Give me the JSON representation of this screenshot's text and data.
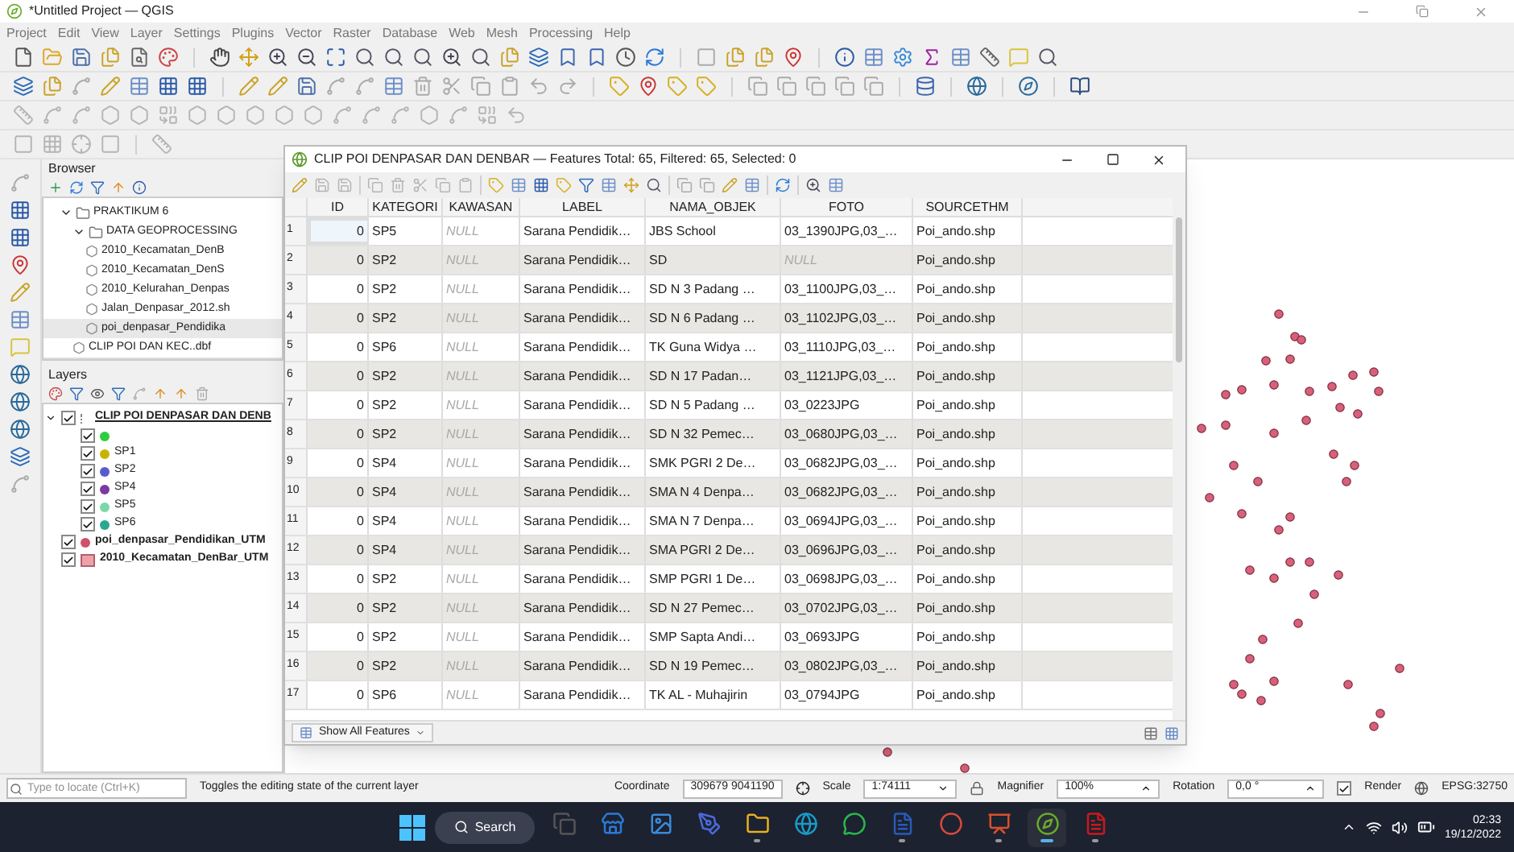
{
  "window": {
    "title": "*Untitled Project — QGIS"
  },
  "menu": [
    "Project",
    "Edit",
    "View",
    "Layer",
    "Settings",
    "Plugins",
    "Vector",
    "Raster",
    "Database",
    "Web",
    "Mesh",
    "Processing",
    "Help"
  ],
  "browser": {
    "title": "Browser",
    "items": [
      {
        "label": "PRAKTIKUM 6",
        "kind": "folder",
        "expanded": true,
        "selected": false,
        "children": [
          {
            "label": "DATA GEOPROCESSING",
            "kind": "folder",
            "expanded": true,
            "selected": false,
            "children": [
              {
                "label": "2010_Kecamatan_DenB",
                "kind": "file",
                "selected": false
              },
              {
                "label": "2010_Kecamatan_DenS",
                "kind": "file",
                "selected": false
              },
              {
                "label": "2010_Kelurahan_Denpas",
                "kind": "file",
                "selected": false
              },
              {
                "label": "Jalan_Denpasar_2012.sh",
                "kind": "file",
                "selected": false
              },
              {
                "label": "poi_denpasar_Pendidika",
                "kind": "file",
                "selected": true
              }
            ]
          },
          {
            "label": "CLIP POI DAN KEC..dbf",
            "kind": "file",
            "selected": false
          }
        ]
      }
    ]
  },
  "layers": {
    "title": "Layers",
    "items": [
      {
        "label": "CLIP POI DENPASAR DAN DENB",
        "checked": true,
        "expanded": true,
        "kind": "group",
        "children": [
          {
            "checked": true,
            "kind": "point",
            "color": "#2ecc40"
          },
          {
            "label": "SP1",
            "checked": true,
            "kind": "point",
            "color": "#c8b400"
          },
          {
            "label": "SP2",
            "checked": true,
            "kind": "point",
            "color": "#5a5ad0"
          },
          {
            "label": "SP4",
            "checked": true,
            "kind": "point",
            "color": "#7a3aa0"
          },
          {
            "label": "SP5",
            "checked": true,
            "kind": "point",
            "color": "#7ad8a8"
          },
          {
            "label": "SP6",
            "checked": true,
            "kind": "point",
            "color": "#2aa890"
          }
        ]
      },
      {
        "label": "poi_denpasar_Pendidikan_UTM",
        "checked": true,
        "kind": "point",
        "color": "#d0506a"
      },
      {
        "label": "2010_Kecamatan_DenBar_UTM",
        "checked": true,
        "kind": "polygon",
        "color": "#f0a0a8"
      }
    ]
  },
  "attribute_table": {
    "title": "CLIP POI DENPASAR DAN DENBAR — Features Total: 65, Filtered: 65, Selected: 0",
    "columns": [
      "ID",
      "KATEGORI",
      "KAWASAN",
      "LABEL",
      "NAMA_OBJEK",
      "FOTO",
      "SOURCETHM"
    ],
    "rows": [
      {
        "number": "1",
        "cells": [
          {
            "text": "0",
            "null": false,
            "focused": true
          },
          {
            "text": "SP5",
            "null": false,
            "focused": false
          },
          {
            "text": "NULL",
            "null": true,
            "focused": false
          },
          {
            "text": "Sarana Pendidik…",
            "null": false,
            "focused": false
          },
          {
            "text": "JBS School",
            "null": false,
            "focused": false
          },
          {
            "text": "03_1390JPG,03_…",
            "null": false,
            "focused": false
          },
          {
            "text": "Poi_ando.shp",
            "null": false,
            "focused": false
          }
        ]
      },
      {
        "number": "2",
        "cells": [
          {
            "text": "0",
            "null": false,
            "focused": false
          },
          {
            "text": "SP2",
            "null": false,
            "focused": false
          },
          {
            "text": "NULL",
            "null": true,
            "focused": false
          },
          {
            "text": "Sarana Pendidik…",
            "null": false,
            "focused": false
          },
          {
            "text": "SD",
            "null": false,
            "focused": false
          },
          {
            "text": "NULL",
            "null": true,
            "focused": false
          },
          {
            "text": "Poi_ando.shp",
            "null": false,
            "focused": false
          }
        ]
      },
      {
        "number": "3",
        "cells": [
          {
            "text": "0",
            "null": false,
            "focused": false
          },
          {
            "text": "SP2",
            "null": false,
            "focused": false
          },
          {
            "text": "NULL",
            "null": true,
            "focused": false
          },
          {
            "text": "Sarana Pendidik…",
            "null": false,
            "focused": false
          },
          {
            "text": "SD N 3 Padang …",
            "null": false,
            "focused": false
          },
          {
            "text": "03_1100JPG,03_…",
            "null": false,
            "focused": false
          },
          {
            "text": "Poi_ando.shp",
            "null": false,
            "focused": false
          }
        ]
      },
      {
        "number": "4",
        "cells": [
          {
            "text": "0",
            "null": false,
            "focused": false
          },
          {
            "text": "SP2",
            "null": false,
            "focused": false
          },
          {
            "text": "NULL",
            "null": true,
            "focused": false
          },
          {
            "text": "Sarana Pendidik…",
            "null": false,
            "focused": false
          },
          {
            "text": "SD N 6 Padang …",
            "null": false,
            "focused": false
          },
          {
            "text": "03_1102JPG,03_…",
            "null": false,
            "focused": false
          },
          {
            "text": "Poi_ando.shp",
            "null": false,
            "focused": false
          }
        ]
      },
      {
        "number": "5",
        "cells": [
          {
            "text": "0",
            "null": false,
            "focused": false
          },
          {
            "text": "SP6",
            "null": false,
            "focused": false
          },
          {
            "text": "NULL",
            "null": true,
            "focused": false
          },
          {
            "text": "Sarana Pendidik…",
            "null": false,
            "focused": false
          },
          {
            "text": "TK Guna Widya …",
            "null": false,
            "focused": false
          },
          {
            "text": "03_1110JPG,03_…",
            "null": false,
            "focused": false
          },
          {
            "text": "Poi_ando.shp",
            "null": false,
            "focused": false
          }
        ]
      },
      {
        "number": "6",
        "cells": [
          {
            "text": "0",
            "null": false,
            "focused": false
          },
          {
            "text": "SP2",
            "null": false,
            "focused": false
          },
          {
            "text": "NULL",
            "null": true,
            "focused": false
          },
          {
            "text": "Sarana Pendidik…",
            "null": false,
            "focused": false
          },
          {
            "text": "SD N 17 Padan…",
            "null": false,
            "focused": false
          },
          {
            "text": "03_1121JPG,03_…",
            "null": false,
            "focused": false
          },
          {
            "text": "Poi_ando.shp",
            "null": false,
            "focused": false
          }
        ]
      },
      {
        "number": "7",
        "cells": [
          {
            "text": "0",
            "null": false,
            "focused": false
          },
          {
            "text": "SP2",
            "null": false,
            "focused": false
          },
          {
            "text": "NULL",
            "null": true,
            "focused": false
          },
          {
            "text": "Sarana Pendidik…",
            "null": false,
            "focused": false
          },
          {
            "text": "SD N 5 Padang …",
            "null": false,
            "focused": false
          },
          {
            "text": "03_0223JPG",
            "null": false,
            "focused": false
          },
          {
            "text": "Poi_ando.shp",
            "null": false,
            "focused": false
          }
        ]
      },
      {
        "number": "8",
        "cells": [
          {
            "text": "0",
            "null": false,
            "focused": false
          },
          {
            "text": "SP2",
            "null": false,
            "focused": false
          },
          {
            "text": "NULL",
            "null": true,
            "focused": false
          },
          {
            "text": "Sarana Pendidik…",
            "null": false,
            "focused": false
          },
          {
            "text": "SD N 32 Pemec…",
            "null": false,
            "focused": false
          },
          {
            "text": "03_0680JPG,03_…",
            "null": false,
            "focused": false
          },
          {
            "text": "Poi_ando.shp",
            "null": false,
            "focused": false
          }
        ]
      },
      {
        "number": "9",
        "cells": [
          {
            "text": "0",
            "null": false,
            "focused": false
          },
          {
            "text": "SP4",
            "null": false,
            "focused": false
          },
          {
            "text": "NULL",
            "null": true,
            "focused": false
          },
          {
            "text": "Sarana Pendidik…",
            "null": false,
            "focused": false
          },
          {
            "text": "SMK PGRI 2 De…",
            "null": false,
            "focused": false
          },
          {
            "text": "03_0682JPG,03_…",
            "null": false,
            "focused": false
          },
          {
            "text": "Poi_ando.shp",
            "null": false,
            "focused": false
          }
        ]
      },
      {
        "number": "10",
        "cells": [
          {
            "text": "0",
            "null": false,
            "focused": false
          },
          {
            "text": "SP4",
            "null": false,
            "focused": false
          },
          {
            "text": "NULL",
            "null": true,
            "focused": false
          },
          {
            "text": "Sarana Pendidik…",
            "null": false,
            "focused": false
          },
          {
            "text": "SMA N 4 Denpa…",
            "null": false,
            "focused": false
          },
          {
            "text": "03_0682JPG,03_…",
            "null": false,
            "focused": false
          },
          {
            "text": "Poi_ando.shp",
            "null": false,
            "focused": false
          }
        ]
      },
      {
        "number": "11",
        "cells": [
          {
            "text": "0",
            "null": false,
            "focused": false
          },
          {
            "text": "SP4",
            "null": false,
            "focused": false
          },
          {
            "text": "NULL",
            "null": true,
            "focused": false
          },
          {
            "text": "Sarana Pendidik…",
            "null": false,
            "focused": false
          },
          {
            "text": "SMA N 7 Denpa…",
            "null": false,
            "focused": false
          },
          {
            "text": "03_0694JPG,03_…",
            "null": false,
            "focused": false
          },
          {
            "text": "Poi_ando.shp",
            "null": false,
            "focused": false
          }
        ]
      },
      {
        "number": "12",
        "cells": [
          {
            "text": "0",
            "null": false,
            "focused": false
          },
          {
            "text": "SP4",
            "null": false,
            "focused": false
          },
          {
            "text": "NULL",
            "null": true,
            "focused": false
          },
          {
            "text": "Sarana Pendidik…",
            "null": false,
            "focused": false
          },
          {
            "text": "SMA PGRI 2 De…",
            "null": false,
            "focused": false
          },
          {
            "text": "03_0696JPG,03_…",
            "null": false,
            "focused": false
          },
          {
            "text": "Poi_ando.shp",
            "null": false,
            "focused": false
          }
        ]
      },
      {
        "number": "13",
        "cells": [
          {
            "text": "0",
            "null": false,
            "focused": false
          },
          {
            "text": "SP2",
            "null": false,
            "focused": false
          },
          {
            "text": "NULL",
            "null": true,
            "focused": false
          },
          {
            "text": "Sarana Pendidik…",
            "null": false,
            "focused": false
          },
          {
            "text": "SMP PGRI 1 De…",
            "null": false,
            "focused": false
          },
          {
            "text": "03_0698JPG,03_…",
            "null": false,
            "focused": false
          },
          {
            "text": "Poi_ando.shp",
            "null": false,
            "focused": false
          }
        ]
      },
      {
        "number": "14",
        "cells": [
          {
            "text": "0",
            "null": false,
            "focused": false
          },
          {
            "text": "SP2",
            "null": false,
            "focused": false
          },
          {
            "text": "NULL",
            "null": true,
            "focused": false
          },
          {
            "text": "Sarana Pendidik…",
            "null": false,
            "focused": false
          },
          {
            "text": "SD N 27 Pemec…",
            "null": false,
            "focused": false
          },
          {
            "text": "03_0702JPG,03_…",
            "null": false,
            "focused": false
          },
          {
            "text": "Poi_ando.shp",
            "null": false,
            "focused": false
          }
        ]
      },
      {
        "number": "15",
        "cells": [
          {
            "text": "0",
            "null": false,
            "focused": false
          },
          {
            "text": "SP2",
            "null": false,
            "focused": false
          },
          {
            "text": "NULL",
            "null": true,
            "focused": false
          },
          {
            "text": "Sarana Pendidik…",
            "null": false,
            "focused": false
          },
          {
            "text": "SMP Sapta Andi…",
            "null": false,
            "focused": false
          },
          {
            "text": "03_0693JPG",
            "null": false,
            "focused": false
          },
          {
            "text": "Poi_ando.shp",
            "null": false,
            "focused": false
          }
        ]
      },
      {
        "number": "16",
        "cells": [
          {
            "text": "0",
            "null": false,
            "focused": false
          },
          {
            "text": "SP2",
            "null": false,
            "focused": false
          },
          {
            "text": "NULL",
            "null": true,
            "focused": false
          },
          {
            "text": "Sarana Pendidik…",
            "null": false,
            "focused": false
          },
          {
            "text": "SD N 19 Pemec…",
            "null": false,
            "focused": false
          },
          {
            "text": "03_0802JPG,03_…",
            "null": false,
            "focused": false
          },
          {
            "text": "Poi_ando.shp",
            "null": false,
            "focused": false
          }
        ]
      },
      {
        "number": "17",
        "cells": [
          {
            "text": "0",
            "null": false,
            "focused": false
          },
          {
            "text": "SP6",
            "null": false,
            "focused": false
          },
          {
            "text": "NULL",
            "null": true,
            "focused": false
          },
          {
            "text": "Sarana Pendidik…",
            "null": false,
            "focused": false
          },
          {
            "text": "TK AL - Muhajirin",
            "null": false,
            "focused": false
          },
          {
            "text": "03_0794JPG",
            "null": false,
            "focused": false
          },
          {
            "text": "Poi_ando.shp",
            "null": false,
            "focused": false
          }
        ]
      }
    ],
    "filter_button": "Show All Features"
  },
  "status_bar": {
    "locate_placeholder": "Type to locate (Ctrl+K)",
    "message": "Toggles the editing state of the current layer",
    "coordinate_label": "Coordinate",
    "coordinate": "309679 9041190",
    "scale_label": "Scale",
    "scale": "1:74111",
    "magnifier_label": "Magnifier",
    "magnifier": "100%",
    "rotation_label": "Rotation",
    "rotation": "0,0 °",
    "render": {
      "label": "Render",
      "checked": true
    },
    "crs": "EPSG:32750"
  },
  "taskbar": {
    "search": "Search",
    "apps": [
      {
        "kind": "taskview",
        "running": false,
        "selected": false
      },
      {
        "kind": "store",
        "running": false,
        "selected": false
      },
      {
        "kind": "photos",
        "running": false,
        "selected": false
      },
      {
        "kind": "pen",
        "running": false,
        "selected": false
      },
      {
        "kind": "explorer",
        "running": true,
        "selected": false
      },
      {
        "kind": "edge",
        "running": false,
        "selected": false
      },
      {
        "kind": "whatsapp",
        "running": false,
        "selected": false
      },
      {
        "kind": "word",
        "running": true,
        "selected": false
      },
      {
        "kind": "chrome",
        "running": false,
        "selected": false
      },
      {
        "kind": "powerpoint",
        "running": true,
        "selected": false
      },
      {
        "kind": "qgis",
        "running": true,
        "selected": true
      },
      {
        "kind": "acrobat",
        "running": true,
        "selected": false
      }
    ],
    "time": "02:33",
    "date": "19/12/2022"
  }
}
